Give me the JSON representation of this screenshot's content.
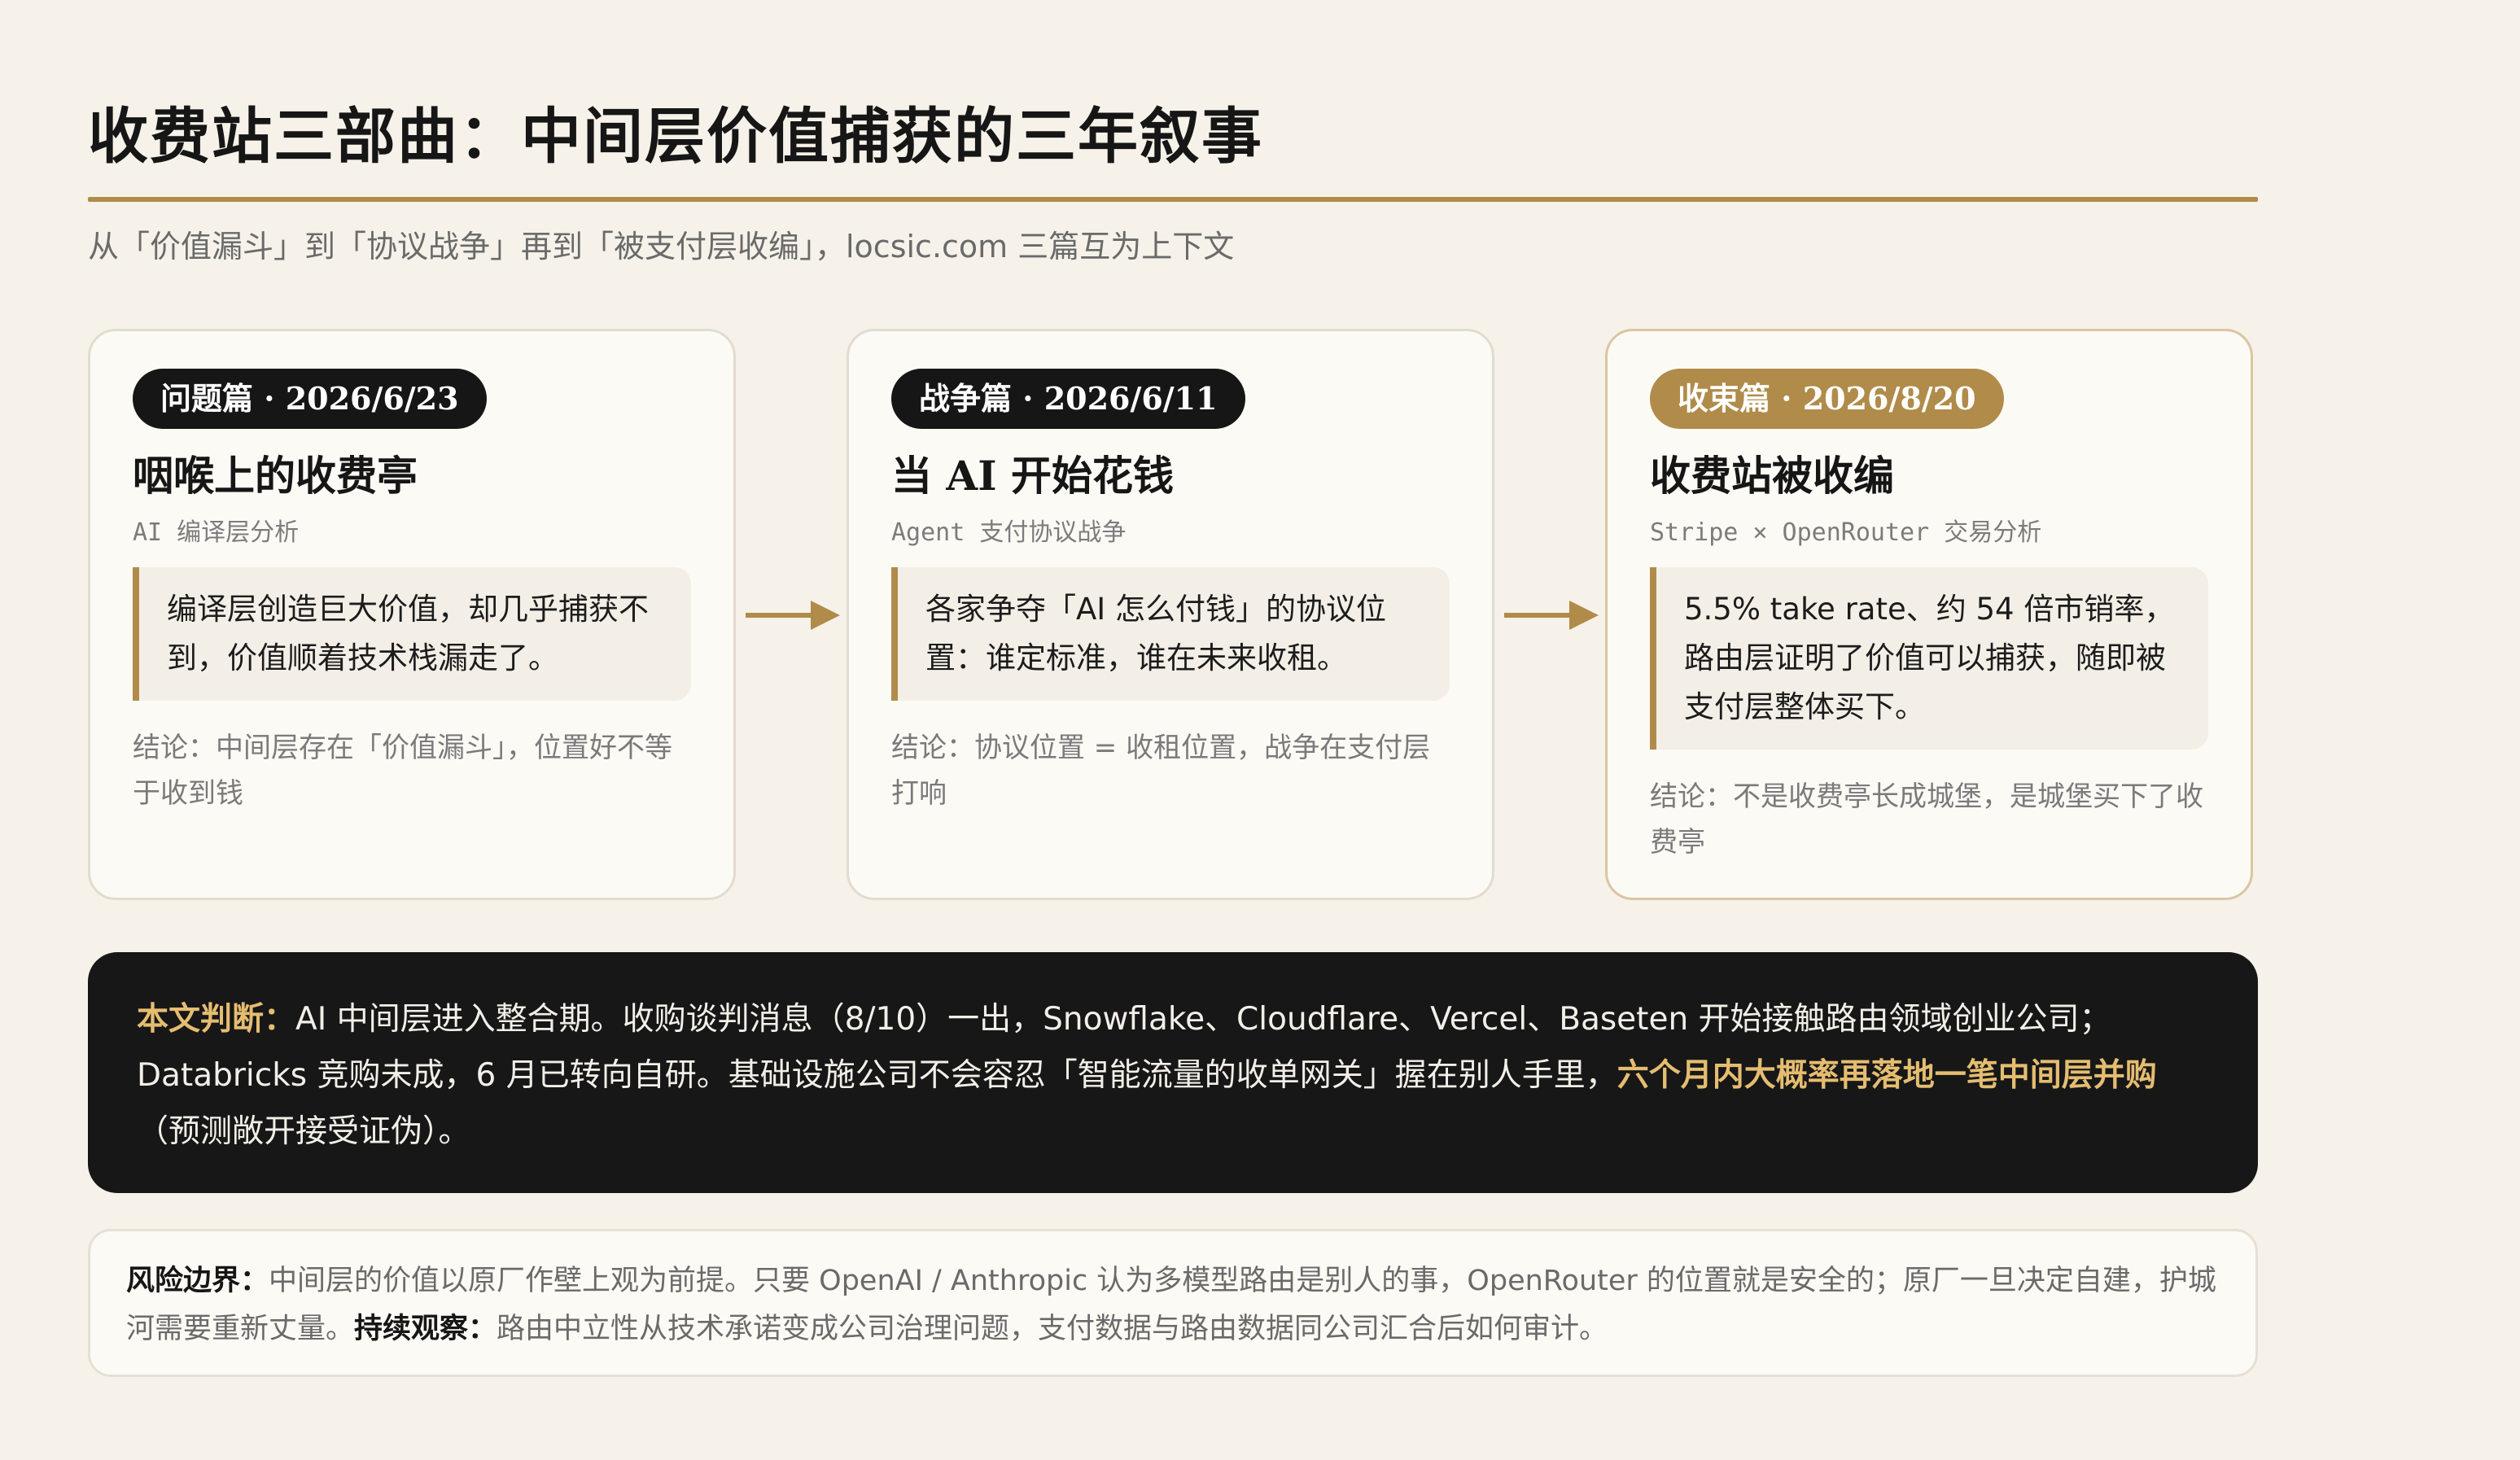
{
  "page": {
    "title": "收费站三部曲：中间层价值捕获的三年叙事",
    "subtitle": "从「价值漏斗」到「协议战争」再到「被支付层收编」，locsic.com 三篇互为上下文"
  },
  "cards": [
    {
      "badge": "问题篇 · 2026/6/23",
      "title": "咽喉上的收费亭",
      "tag": "AI 编译层分析",
      "quote": "编译层创造巨大价值，却几乎捕获不到，价值顺着技术栈漏走了。",
      "conclusion": "结论：中间层存在「价值漏斗」，位置好不等于收到钱"
    },
    {
      "badge": "战争篇 · 2026/6/11",
      "title": "当 AI 开始花钱",
      "tag": "Agent 支付协议战争",
      "quote": "各家争夺「AI 怎么付钱」的协议位置：谁定标准，谁在未来收租。",
      "conclusion": "结论：协议位置 = 收租位置，战争在支付层打响"
    },
    {
      "badge": "收束篇 · 2026/8/20",
      "title": "收费站被收编",
      "tag": "Stripe × OpenRouter 交易分析",
      "quote": "5.5% take rate、约 54 倍市销率，路由层证明了价值可以捕获，随即被支付层整体买下。",
      "conclusion": "结论：不是收费亭长成城堡，是城堡买下了收费亭"
    }
  ],
  "judgement": {
    "label": "本文判断：",
    "text": "AI 中间层进入整合期。收购谈判消息（8/10）一出，Snowflake、Cloudflare、Vercel、Baseten 开始接触路由领域创业公司；Databricks 竞购未成，6 月已转向自研。基础设施公司不会容忍「智能流量的收单网关」握在别人手里，",
    "highlight": "六个月内大概率再落地一笔中间层并购",
    "tail": "（预测敞开接受证伪）。"
  },
  "risk": {
    "label1": "风险边界：",
    "text1": "中间层的价值以原厂作壁上观为前提。只要 OpenAI / Anthropic 认为多模型路由是别人的事，OpenRouter 的位置就是安全的；原厂一旦决定自建，护城河需要重新丈量。",
    "label2": "持续观察：",
    "text2": "路由中立性从技术承诺变成公司治理问题，支付数据与路由数据同公司汇合后如何审计。"
  },
  "colors": {
    "background": "#f6f2e9",
    "accent_gold": "#b08b4a",
    "dark_panel": "#171717",
    "highlight_text": "#e5bd70"
  }
}
